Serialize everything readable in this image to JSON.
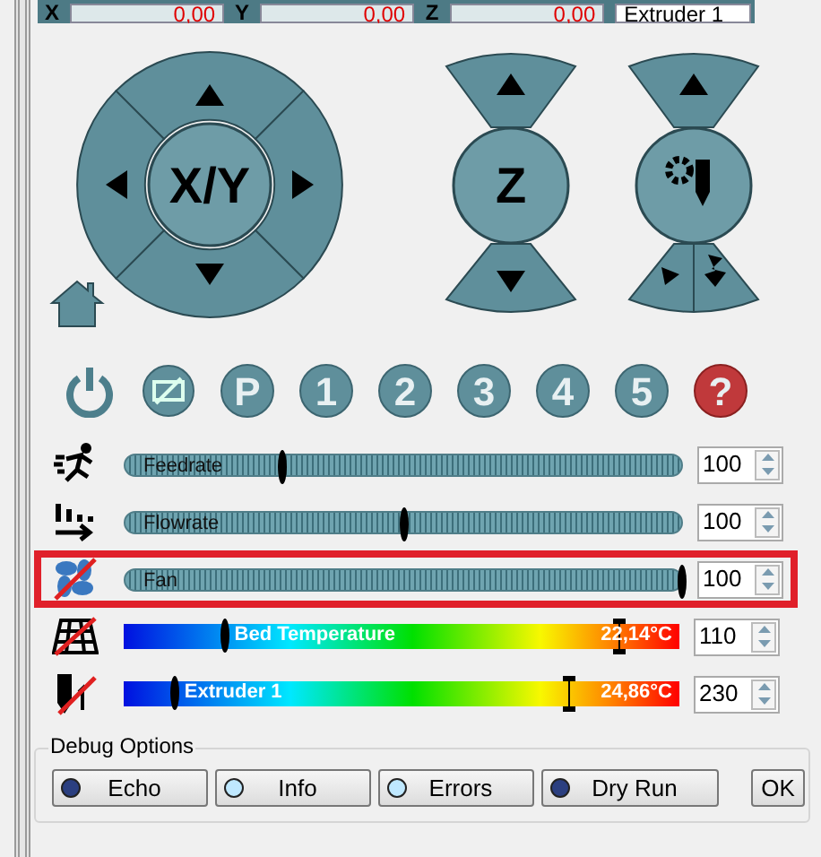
{
  "position_bar": [
    {
      "axis": "X",
      "value": "0,00"
    },
    {
      "axis": "Y",
      "value": "0,00"
    },
    {
      "axis": "Z",
      "value": "0,00"
    }
  ],
  "extruder_select": "Extruder 1",
  "xy_pad": {
    "label": "X/Y"
  },
  "z_pad": {
    "label": "Z"
  },
  "function_buttons": [
    {
      "kind": "power"
    },
    {
      "kind": "display"
    },
    {
      "kind": "text",
      "label": "P"
    },
    {
      "kind": "text",
      "label": "1"
    },
    {
      "kind": "text",
      "label": "2"
    },
    {
      "kind": "text",
      "label": "3"
    },
    {
      "kind": "text",
      "label": "4"
    },
    {
      "kind": "text",
      "label": "5"
    },
    {
      "kind": "help",
      "label": "?"
    }
  ],
  "sliders": [
    {
      "kind": "plain",
      "label": "Feedrate",
      "level": 0.28,
      "value": "100",
      "highlighted": false
    },
    {
      "kind": "plain",
      "label": "Flowrate",
      "level": 0.5,
      "value": "100",
      "highlighted": false
    },
    {
      "kind": "plain",
      "label": "Fan",
      "level": 1,
      "value": "100",
      "highlighted": true
    },
    {
      "kind": "temperature",
      "label": "Bed Temperature",
      "level": 0.18,
      "marker": {
        "level": 0.89
      },
      "reading": "22,14°C",
      "value": "110",
      "highlighted": false
    },
    {
      "kind": "temperature",
      "label": "Extruder 1",
      "level": 0.09,
      "marker": {
        "level": 0.8
      },
      "reading": "24,86°C",
      "value": "230",
      "highlighted": false
    }
  ],
  "debug_options": {
    "title": "Debug Options",
    "buttons": [
      {
        "label": "Echo",
        "on": false
      },
      {
        "label": "Info",
        "on": true
      },
      {
        "label": "Errors",
        "on": true
      },
      {
        "label": "Dry Run",
        "on": false
      }
    ],
    "ok": "OK"
  }
}
